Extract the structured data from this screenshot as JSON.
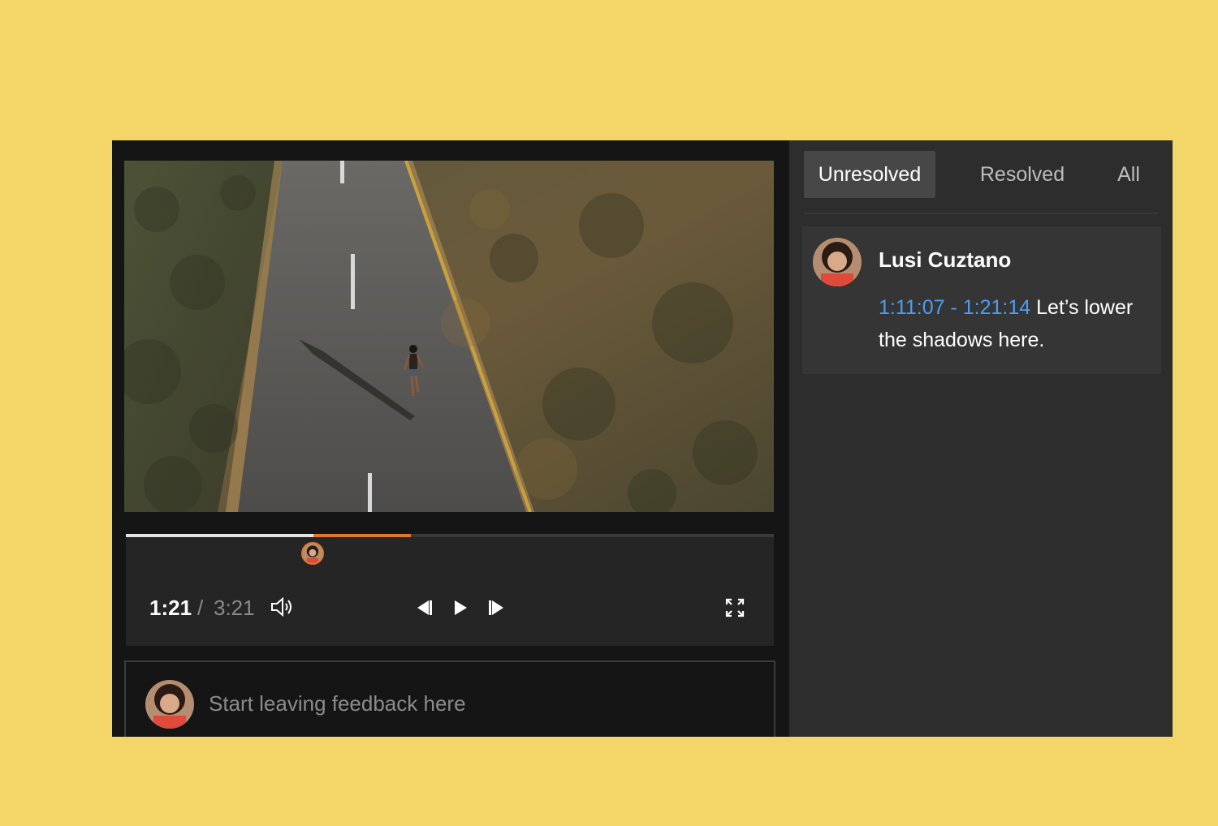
{
  "player": {
    "current_time": "1:21",
    "separator": "/",
    "total_time": "3:21",
    "progress_fraction": 0.29,
    "comment_range_fraction": [
      0.29,
      0.44
    ],
    "comment_marker_fraction": 0.29,
    "icons": [
      "volume-icon",
      "skip-back-icon",
      "play-icon",
      "skip-forward-icon",
      "fullscreen-icon"
    ]
  },
  "feedback": {
    "placeholder": "Start leaving feedback here"
  },
  "tabs": [
    {
      "label": "Unresolved",
      "active": true
    },
    {
      "label": "Resolved",
      "active": false
    },
    {
      "label": "All",
      "active": false
    }
  ],
  "comments": [
    {
      "author": "Lusi Cuztano",
      "timecode": "1:11:07 - 1:21:14",
      "text": " Let’s lower the shadows here."
    }
  ],
  "colors": {
    "background": "#f3d568",
    "accent_orange": "#e0782a",
    "timecode_blue": "#4f9cf5"
  }
}
